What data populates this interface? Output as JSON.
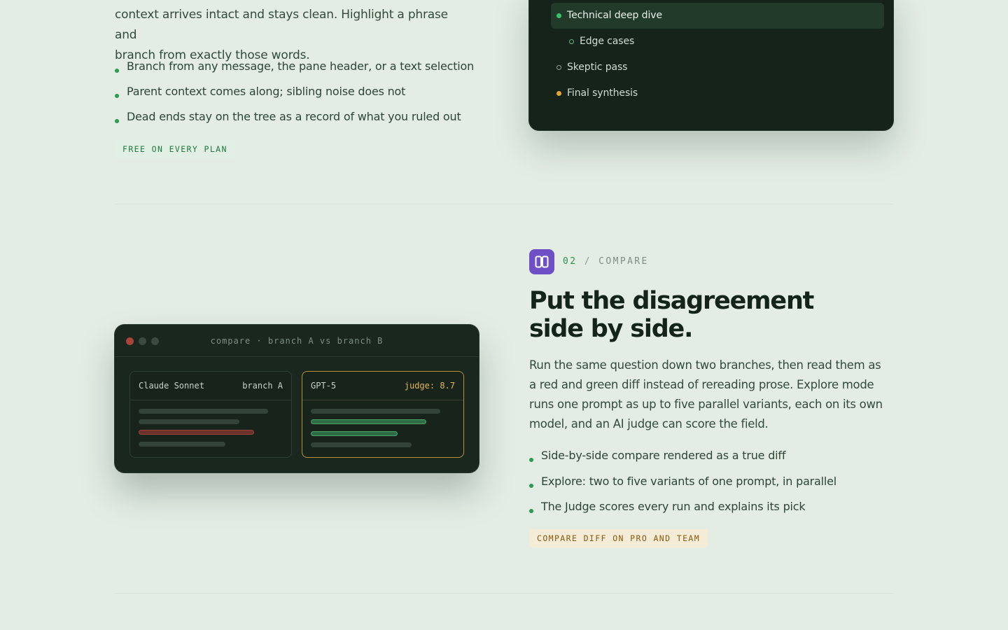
{
  "section1": {
    "intro": "context arrives intact and stays clean. Highlight a phrase and branch from exactly those words.",
    "intro_lines": [
      "context arrives intact and stays clean. Highlight a phrase and",
      "branch from exactly those words."
    ],
    "bullets": [
      "Branch from any message, the pane header, or a text selection",
      "Parent context comes along; sibling noise does not",
      "Dead ends stay on the tree as a record of what you ruled out"
    ],
    "pill": "FREE ON EVERY PLAN"
  },
  "tree": {
    "items": [
      {
        "label": "Technical deep dive",
        "state": "active",
        "indent": 0
      },
      {
        "label": "Edge cases",
        "state": "ring",
        "indent": 1
      },
      {
        "label": "Skeptic pass",
        "state": "ring-gray",
        "indent": 0
      },
      {
        "label": "Final synthesis",
        "state": "amber",
        "indent": 0
      }
    ]
  },
  "compare_window": {
    "title": "compare · branch A vs branch B",
    "left_card": {
      "model": "Claude Sonnet",
      "tag": "branch A"
    },
    "right_card": {
      "model": "GPT-5",
      "tag": "judge: 8.7"
    }
  },
  "section2": {
    "number": "02",
    "separator": "/",
    "label": "COMPARE",
    "headline_line1": "Put the disagreement",
    "headline_line2": "side by side.",
    "body": "Run the same question down two branches, then read them as a red and green diff instead of rereading prose. Explore mode runs one prompt as up to five parallel variants, each on its own model, and an AI judge can score the field.",
    "bullets": [
      "Side-by-side compare rendered as a true diff",
      "Explore: two to five variants of one prompt, in parallel",
      "The Judge scores every run and explains its pick"
    ],
    "pill": "COMPARE DIFF ON PRO AND TEAM"
  },
  "colors": {
    "background": "#e3ede4",
    "accent_green": "#2a9b53",
    "icon_purple": "#6f4fc6",
    "judge_gold": "#e2b64a",
    "dark_panel": "#16231b"
  },
  "icons": {
    "compare_icon": "columns-icon"
  }
}
